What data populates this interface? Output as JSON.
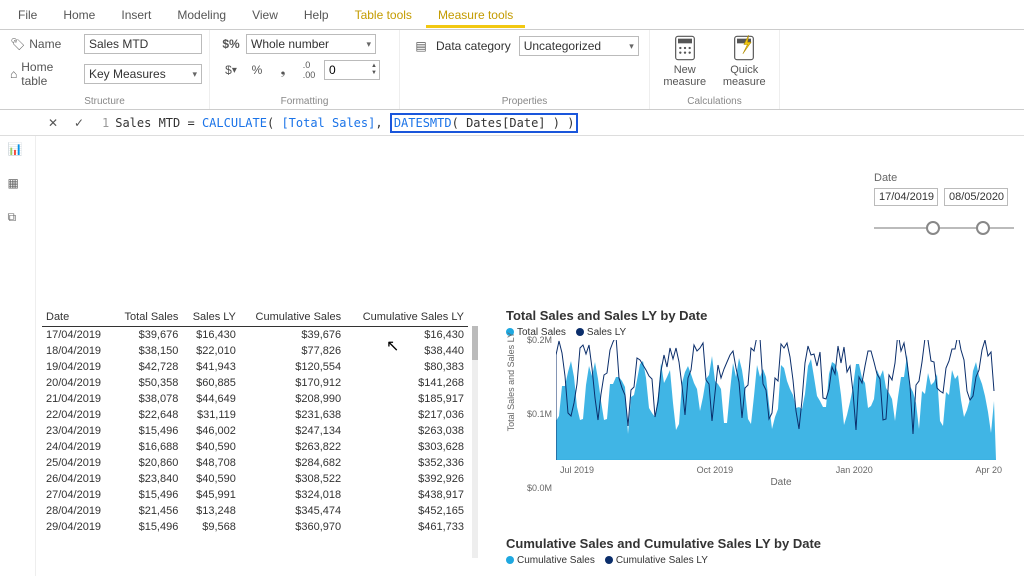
{
  "menubar": {
    "items": [
      "File",
      "Home",
      "Insert",
      "Modeling",
      "View",
      "Help",
      "Table tools",
      "Measure tools"
    ],
    "context_start": 6,
    "active": 7
  },
  "ribbon": {
    "structure": {
      "name_label": "Name",
      "name_value": "Sales MTD",
      "home_label": "Home table",
      "home_value": "Key Measures",
      "group": "Structure"
    },
    "formatting": {
      "fmt_value": "Whole number",
      "spinner": "0",
      "group": "Formatting",
      "icons": [
        "$",
        "%",
        "‚",
        ".00"
      ]
    },
    "properties": {
      "label": "Data category",
      "value": "Uncategorized",
      "group": "Properties"
    },
    "calculations": {
      "new": "New\nmeasure",
      "quick": "Quick\nmeasure",
      "group": "Calculations"
    }
  },
  "formula": {
    "line": "1",
    "measure": "Sales MTD",
    "fn1": "CALCULATE",
    "arg1": "[Total Sales]",
    "fn2": "DATESMTD",
    "arg2": "Dates[Date]"
  },
  "slicer": {
    "label": "Date",
    "from": "17/04/2019",
    "to": "08/05/2020"
  },
  "table": {
    "cols": [
      "Date",
      "Total Sales",
      "Sales LY",
      "Cumulative Sales",
      "Cumulative Sales LY"
    ],
    "rows": [
      [
        "17/04/2019",
        "$39,676",
        "$16,430",
        "$39,676",
        "$16,430"
      ],
      [
        "18/04/2019",
        "$38,150",
        "$22,010",
        "$77,826",
        "$38,440"
      ],
      [
        "19/04/2019",
        "$42,728",
        "$41,943",
        "$120,554",
        "$80,383"
      ],
      [
        "20/04/2019",
        "$50,358",
        "$60,885",
        "$170,912",
        "$141,268"
      ],
      [
        "21/04/2019",
        "$38,078",
        "$44,649",
        "$208,990",
        "$185,917"
      ],
      [
        "22/04/2019",
        "$22,648",
        "$31,119",
        "$231,638",
        "$217,036"
      ],
      [
        "23/04/2019",
        "$15,496",
        "$46,002",
        "$247,134",
        "$263,038"
      ],
      [
        "24/04/2019",
        "$16,688",
        "$40,590",
        "$263,822",
        "$303,628"
      ],
      [
        "25/04/2019",
        "$20,860",
        "$48,708",
        "$284,682",
        "$352,336"
      ],
      [
        "26/04/2019",
        "$23,840",
        "$40,590",
        "$308,522",
        "$392,926"
      ],
      [
        "27/04/2019",
        "$15,496",
        "$45,991",
        "$324,018",
        "$438,917"
      ],
      [
        "28/04/2019",
        "$21,456",
        "$13,248",
        "$345,474",
        "$452,165"
      ],
      [
        "29/04/2019",
        "$15,496",
        "$9,568",
        "$360,970",
        "$461,733"
      ]
    ]
  },
  "chart1": {
    "title": "Total Sales and Sales LY by Date",
    "legend": [
      "Total Sales",
      "Sales LY"
    ],
    "ylabel": "Total Sales and Sales LY",
    "xlabel": "Date",
    "yticks": [
      "$0.2M",
      "$0.1M",
      "$0.0M"
    ],
    "xticks": [
      "Jul 2019",
      "Oct 2019",
      "Jan 2020",
      "Apr 20"
    ]
  },
  "chart2": {
    "title": "Cumulative Sales and Cumulative Sales LY by Date",
    "legend": [
      "Cumulative Sales",
      "Cumulative Sales LY"
    ]
  },
  "chart_data": [
    {
      "type": "area",
      "title": "Total Sales and Sales LY by Date",
      "xlabel": "Date",
      "ylabel": "Total Sales and Sales LY",
      "ylim": [
        0,
        200000
      ],
      "x_range": [
        "17/04/2019",
        "08/05/2020"
      ],
      "series": [
        {
          "name": "Total Sales",
          "color": "#1fa8e0",
          "approx_range": [
            15000,
            150000
          ]
        },
        {
          "name": "Sales LY",
          "color": "#0b2e6b",
          "approx_range": [
            10000,
            180000
          ]
        }
      ],
      "note": "daily values; dense overlapping area/line, values estimated from axis"
    },
    {
      "type": "line",
      "title": "Cumulative Sales and Cumulative Sales LY by Date",
      "series": [
        {
          "name": "Cumulative Sales",
          "color": "#1fa8e0"
        },
        {
          "name": "Cumulative Sales LY",
          "color": "#0b2e6b"
        }
      ],
      "note": "chart body below the fold; only title and legend visible"
    }
  ]
}
